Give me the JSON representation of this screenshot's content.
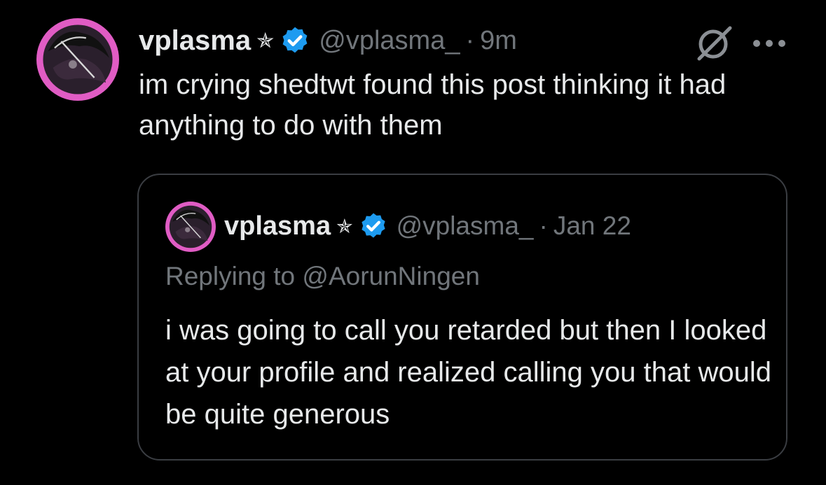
{
  "tweet": {
    "display_name": "vplasma",
    "name_emoji": "✯",
    "handle": "@vplasma_",
    "separator": "·",
    "time": "9m",
    "text": "im crying shedtwt found this post thinking it had anything to do with them"
  },
  "quoted_tweet": {
    "display_name": "vplasma",
    "name_emoji": "✯",
    "handle": "@vplasma_",
    "separator": "·",
    "time": "Jan 22",
    "replying_to": "Replying to @AorunNingen",
    "text": "i was going to call you retarded but then I looked at your profile and realized calling you that would be quite generous"
  },
  "icons": {
    "verified": "verified-badge-icon",
    "grok": "grok-icon",
    "more": "more-options-icon"
  },
  "colors": {
    "background": "#000000",
    "primary_text": "#e7e9ea",
    "secondary_text": "#71767b",
    "verified_blue": "#1d9bf0",
    "avatar_pink": "#e05cc4",
    "quote_border": "#3a3d42"
  }
}
